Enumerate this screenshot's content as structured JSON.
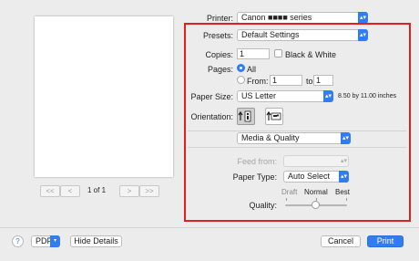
{
  "preview": {
    "page_indicator": "1 of 1",
    "first_label": "<<",
    "prev_label": "<",
    "next_label": ">",
    "last_label": ">>"
  },
  "printer": {
    "label": "Printer:",
    "value": "Canon ■■■■ series"
  },
  "presets": {
    "label": "Presets:",
    "value": "Default Settings"
  },
  "copies": {
    "label": "Copies:",
    "value": "1",
    "bw_label": "Black & White",
    "bw_checked": false
  },
  "pages": {
    "label": "Pages:",
    "all_label": "All",
    "from_label": "From:",
    "from_value": "1",
    "to_label": "to:",
    "to_value": "1"
  },
  "paper_size": {
    "label": "Paper Size:",
    "value": "US Letter",
    "dimensions": "8.50 by 11.00 inches"
  },
  "orientation": {
    "label": "Orientation:",
    "options": [
      "portrait",
      "landscape"
    ],
    "selected": "portrait"
  },
  "panel": {
    "value": "Media & Quality"
  },
  "feed_from": {
    "label": "Feed from:",
    "value": ""
  },
  "paper_type": {
    "label": "Paper Type:",
    "value": "Auto Select"
  },
  "quality": {
    "label": "Quality:",
    "ticks": [
      "Draft",
      "Normal",
      "Best"
    ],
    "level": "Normal"
  },
  "footer": {
    "help_label": "?",
    "pdf_label": "PDF",
    "hide_details_label": "Hide Details",
    "cancel_label": "Cancel",
    "print_label": "Print"
  },
  "colors": {
    "accent": "#2f7cf6",
    "highlight_border": "#e0201c"
  },
  "icons": [
    "chevron-updown-icon",
    "portrait-orientation-icon",
    "landscape-orientation-icon",
    "help-icon"
  ]
}
